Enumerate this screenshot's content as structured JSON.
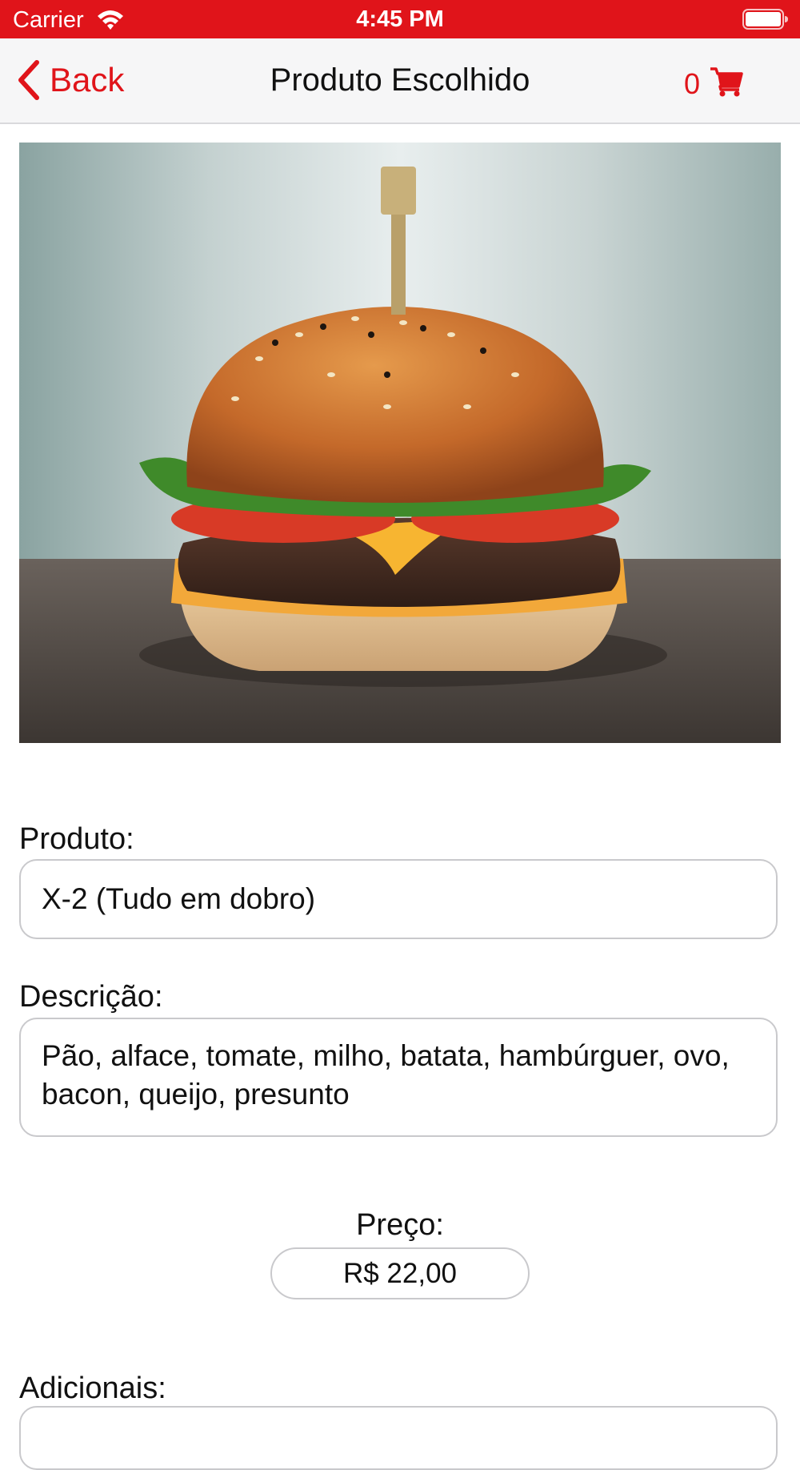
{
  "status_bar": {
    "carrier": "Carrier",
    "time": "4:45 PM",
    "icons": [
      "wifi-icon",
      "battery-icon"
    ],
    "background_color": "#e0141a"
  },
  "nav_bar": {
    "back_label": "Back",
    "title": "Produto Escolhido",
    "cart_count": "0",
    "icons": [
      "back-chevron-icon",
      "cart-icon"
    ],
    "accent_color": "#e0141a"
  },
  "product": {
    "image": "hamburger-photo",
    "name_label": "Produto:",
    "name_value": "X-2 (Tudo em dobro)",
    "description_label": "Descrição:",
    "description_value": "Pão, alface, tomate, milho, batata, hambúrguer, ovo, bacon, queijo, presunto",
    "price_label": "Preço:",
    "price_value": "R$ 22,00",
    "extras_label": "Adicionais:"
  }
}
